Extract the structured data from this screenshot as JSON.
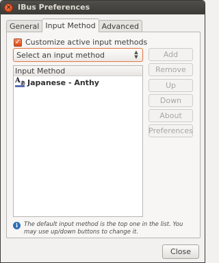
{
  "window": {
    "title": "IBus Preferences",
    "close_glyph": "×"
  },
  "tabs": [
    {
      "label": "General",
      "active": false
    },
    {
      "label": "Input Method",
      "active": true
    },
    {
      "label": "Advanced",
      "active": false
    }
  ],
  "customize": {
    "label": "Customize active input methods",
    "checked": true,
    "check_glyph": "✓"
  },
  "select_method": {
    "value": "Select an input method",
    "arrow_up": "▲",
    "arrow_down": "▼"
  },
  "method_list": {
    "header": "Input Method",
    "items": [
      {
        "name": "Japanese - Anthy",
        "icon": "anthy-icon",
        "icon_big": "A",
        "icon_small": "あ"
      }
    ]
  },
  "buttons": {
    "add": "Add",
    "remove": "Remove",
    "up": "Up",
    "down": "Down",
    "about": "About",
    "preferences": "Preferences"
  },
  "info": {
    "icon_glyph": "i",
    "text": "The default input method is the top one in the list. You may use up/down buttons to change it."
  },
  "footer": {
    "close_label": "Close"
  },
  "colors": {
    "accent": "#dd4814",
    "titlebar": "#3c3b37",
    "info_icon": "#2f6eb5"
  }
}
